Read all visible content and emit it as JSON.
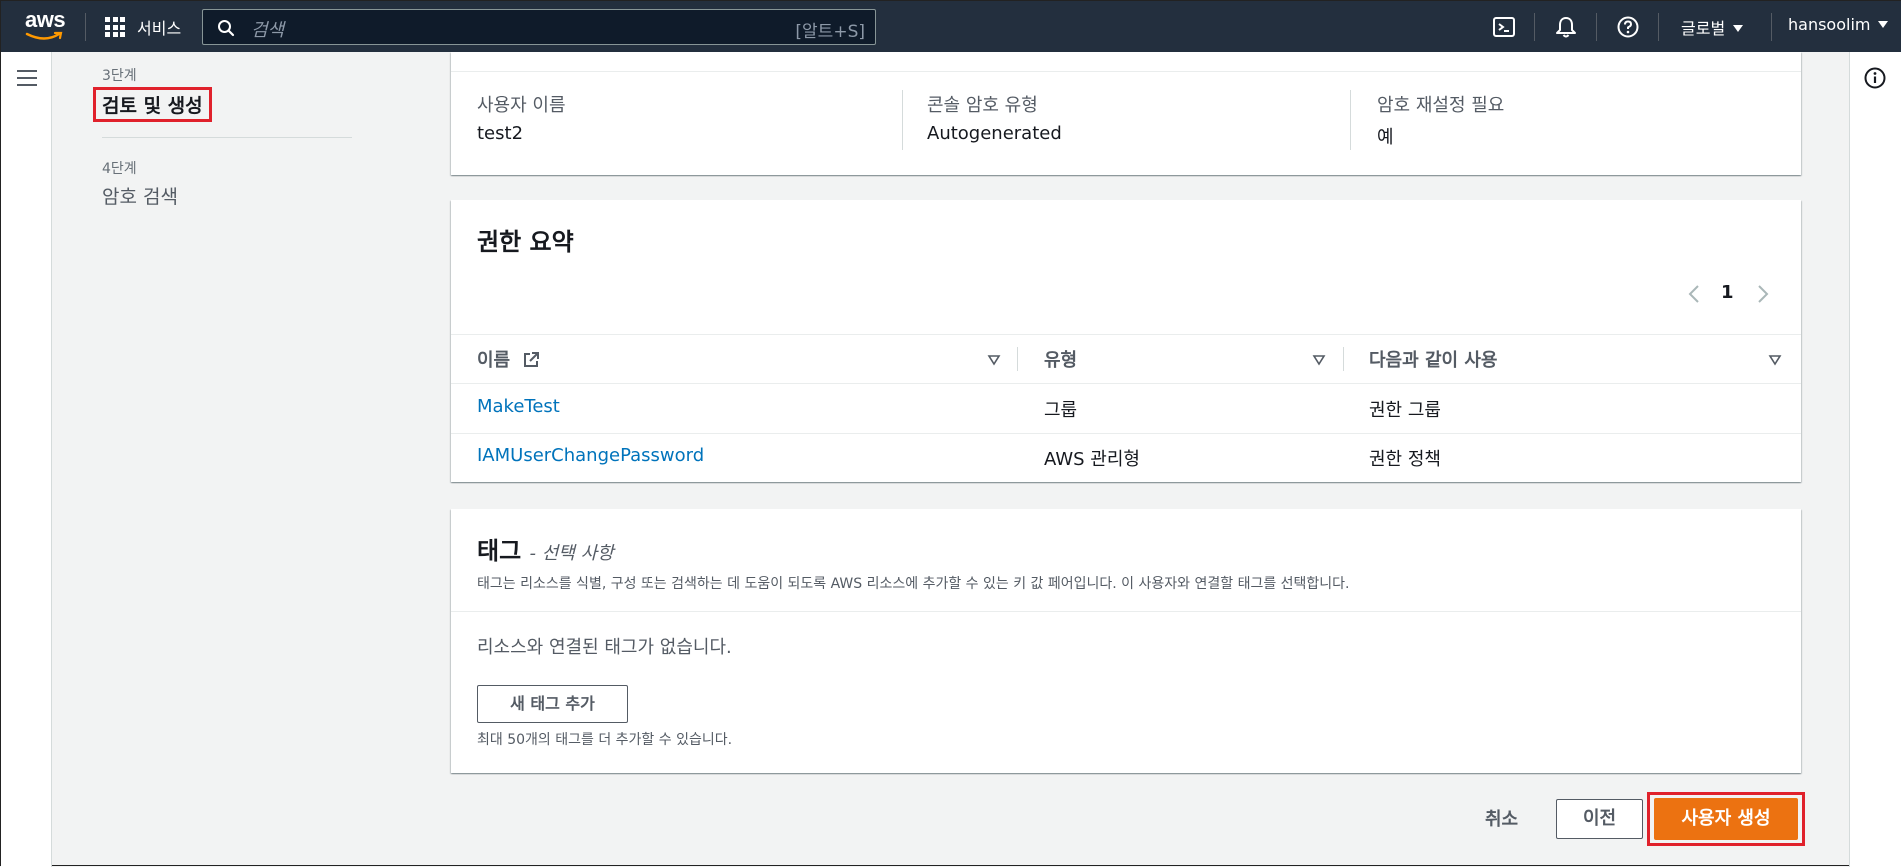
{
  "topnav": {
    "logo_text": "aws",
    "services_label": "서비스",
    "search_placeholder": "검색",
    "search_shortcut": "[알트+S]",
    "region_label": "글로벌",
    "user_label": "hansoolim",
    "icons": [
      "cloudshell-icon",
      "bell-icon",
      "help-icon"
    ]
  },
  "steps": {
    "step3_small": "3단계",
    "step3_title": "검토 및 생성",
    "step4_small": "4단계",
    "step4_title": "암호 검색"
  },
  "user_details": {
    "username_label": "사용자 이름",
    "username_value": "test2",
    "console_pw_label": "콘솔 암호 유형",
    "console_pw_value": "Autogenerated",
    "pw_reset_label": "암호 재설정 필요",
    "pw_reset_value": "예"
  },
  "permissions": {
    "title": "권한 요약",
    "page": "1",
    "columns": [
      "이름",
      "유형",
      "다음과 같이 사용"
    ],
    "rows": [
      {
        "name": "MakeTest",
        "type": "그룹",
        "used_as": "권한 그룹"
      },
      {
        "name": "IAMUserChangePassword",
        "type": "AWS 관리형",
        "used_as": "권한 정책"
      }
    ]
  },
  "tags": {
    "title": "태그",
    "optional": "- 선택 사항",
    "description": "태그는 리소스를 식별, 구성 또는 검색하는 데 도움이 되도록 AWS 리소스에 추가할 수 있는 키 값 페어입니다. 이 사용자와 연결할 태그를 선택합니다.",
    "empty_text": "리소스와 연결된 태그가 없습니다.",
    "add_button": "새 태그 추가",
    "hint": "최대 50개의 태그를 더 추가할 수 있습니다."
  },
  "footer": {
    "cancel": "취소",
    "previous": "이전",
    "create_user": "사용자 생성"
  },
  "colors": {
    "nav_bg": "#232f3e",
    "primary": "#ec7211",
    "link": "#0073bb",
    "highlight": "#e0212b"
  }
}
